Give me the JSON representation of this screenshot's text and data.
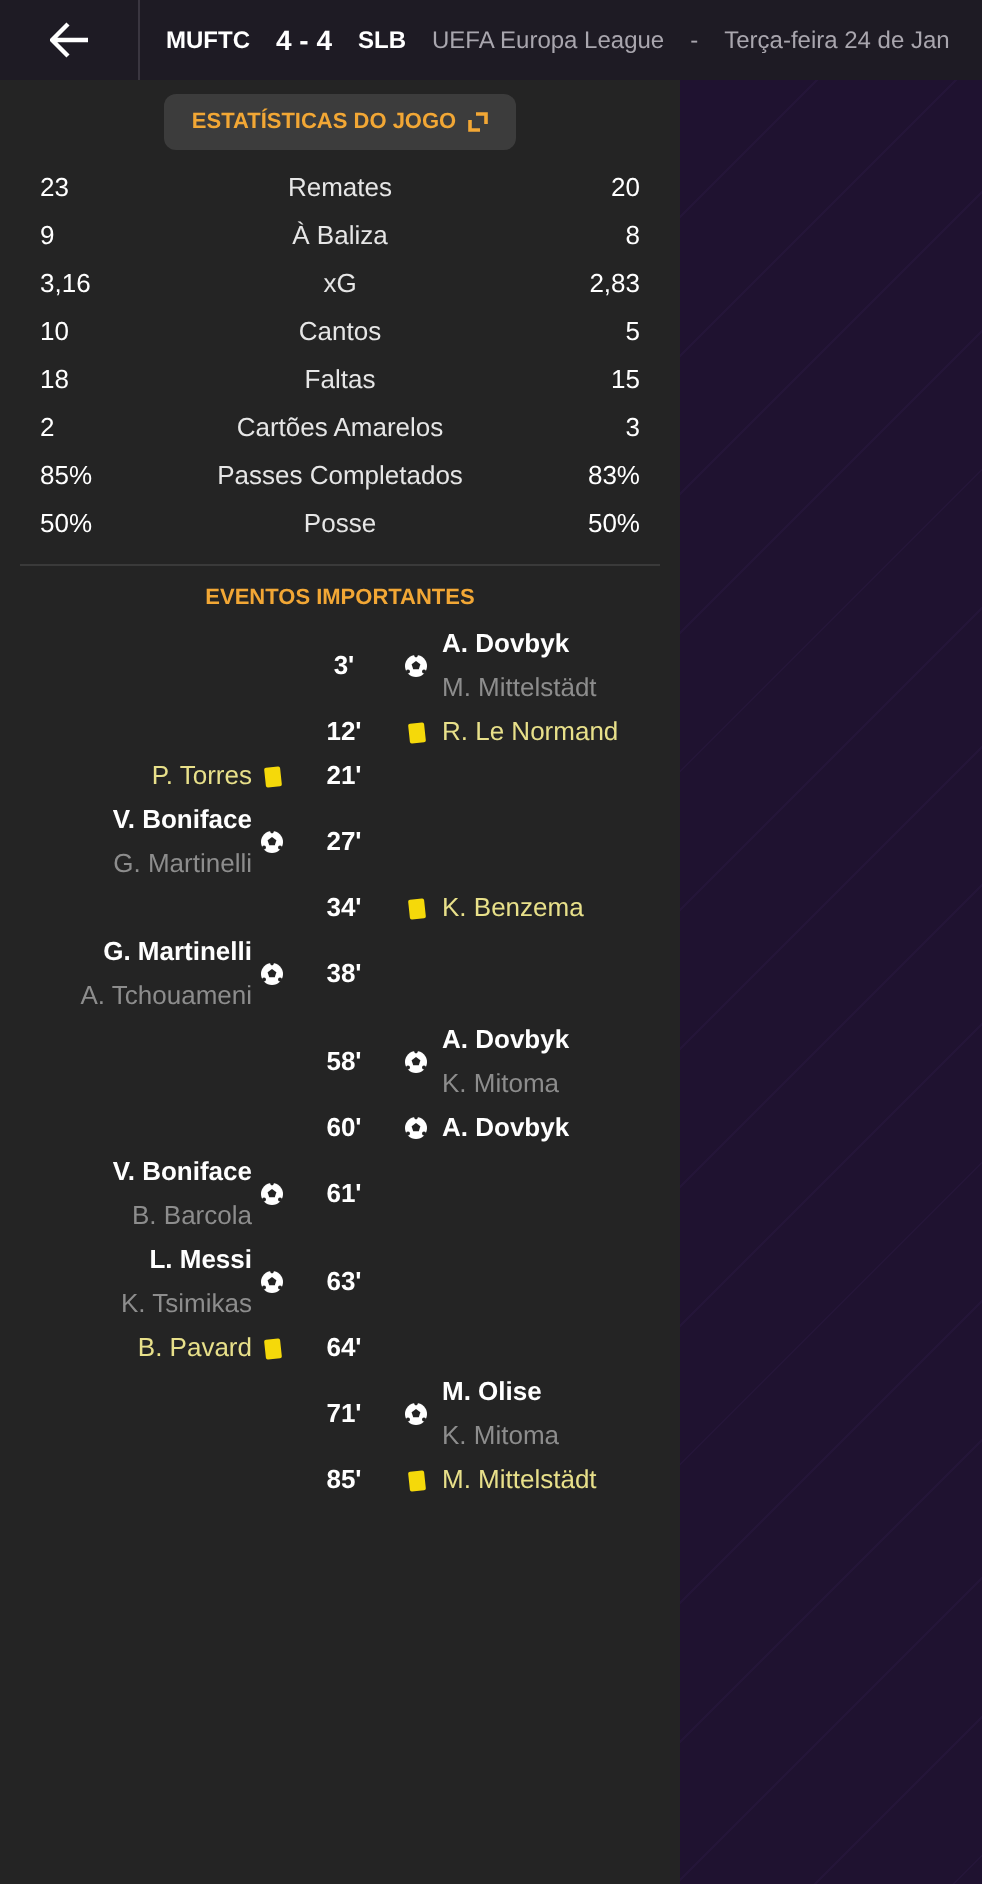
{
  "header": {
    "home": "MUFTC",
    "score": "4 - 4",
    "away": "SLB",
    "competition": "UEFA Europa League",
    "separator": "-",
    "date": "Terça-feira 24 de Jan"
  },
  "stats_button": "ESTATÍSTICAS DO JOGO",
  "stats": [
    {
      "home": "23",
      "label": "Remates",
      "away": "20"
    },
    {
      "home": "9",
      "label": "À Baliza",
      "away": "8"
    },
    {
      "home": "3,16",
      "label": "xG",
      "away": "2,83"
    },
    {
      "home": "10",
      "label": "Cantos",
      "away": "5"
    },
    {
      "home": "18",
      "label": "Faltas",
      "away": "15"
    },
    {
      "home": "2",
      "label": "Cartões Amarelos",
      "away": "3"
    },
    {
      "home": "85%",
      "label": "Passes Completados",
      "away": "83%"
    },
    {
      "home": "50%",
      "label": "Posse",
      "away": "50%"
    }
  ],
  "events_title": "EVENTOS IMPORTANTES",
  "events": [
    {
      "away": true,
      "kind": "goal",
      "minute": "3'",
      "player": "A. Dovbyk",
      "assist": "M. Mittelstädt"
    },
    {
      "away": true,
      "kind": "yellow",
      "minute": "12'",
      "player": "R. Le Normand"
    },
    {
      "away": false,
      "kind": "yellow",
      "minute": "21'",
      "player": "P. Torres"
    },
    {
      "away": false,
      "kind": "goal",
      "minute": "27'",
      "player": "V. Boniface",
      "assist": "G. Martinelli"
    },
    {
      "away": true,
      "kind": "yellow",
      "minute": "34'",
      "player": "K. Benzema"
    },
    {
      "away": false,
      "kind": "goal",
      "minute": "38'",
      "player": "G. Martinelli",
      "assist": "A. Tchouameni"
    },
    {
      "away": true,
      "kind": "goal",
      "minute": "58'",
      "player": "A. Dovbyk",
      "assist": "K. Mitoma"
    },
    {
      "away": true,
      "kind": "goal",
      "minute": "60'",
      "player": "A. Dovbyk"
    },
    {
      "away": false,
      "kind": "goal",
      "minute": "61'",
      "player": "V. Boniface",
      "assist": "B. Barcola"
    },
    {
      "away": false,
      "kind": "goal",
      "minute": "63'",
      "player": "L. Messi",
      "assist": "K. Tsimikas"
    },
    {
      "away": false,
      "kind": "yellow",
      "minute": "64'",
      "player": "B. Pavard"
    },
    {
      "away": true,
      "kind": "goal",
      "minute": "71'",
      "player": "M. Olise",
      "assist": "K. Mitoma"
    },
    {
      "away": true,
      "kind": "yellow",
      "minute": "85'",
      "player": "M. Mittelstädt"
    }
  ]
}
